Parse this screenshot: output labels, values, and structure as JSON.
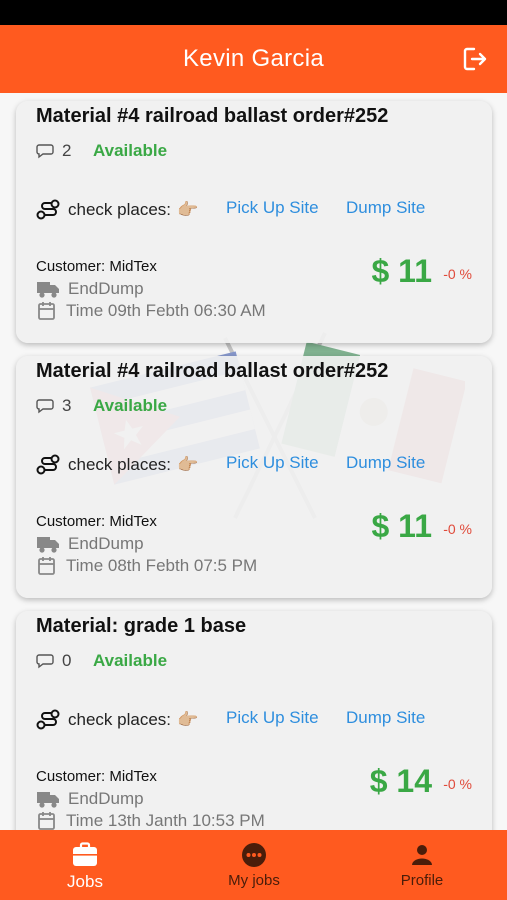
{
  "header": {
    "title": "Kevin Garcia",
    "logout_icon": "logout-icon"
  },
  "jobs": [
    {
      "material": "Material #4 railroad ballast  order#252",
      "comments": "2",
      "status": "Available",
      "check_label": "check places:",
      "hand_icon": "👉🏼",
      "pickup_link": "Pick Up Site",
      "dump_link": "Dump Site",
      "customer": "Customer: MidTex",
      "truck_type": "EndDump",
      "time": "Time 09th Febth 06:30 AM",
      "price": "$ 11",
      "change": "-0 %"
    },
    {
      "material": "Material #4 railroad ballast  order#252",
      "comments": "3",
      "status": "Available",
      "check_label": "check places:",
      "hand_icon": "👉🏼",
      "pickup_link": "Pick Up Site",
      "dump_link": "Dump Site",
      "customer": "Customer: MidTex",
      "truck_type": "EndDump",
      "time": "Time 08th Febth 07:5 PM",
      "price": "$ 11",
      "change": "-0 %"
    },
    {
      "material": "Material: grade 1 base",
      "comments": "0",
      "status": "Available",
      "check_label": "check places:",
      "hand_icon": "👉🏼",
      "pickup_link": "Pick Up Site",
      "dump_link": "Dump Site",
      "customer": "Customer: MidTex",
      "truck_type": "EndDump",
      "time": "Time 13th Janth 10:53 PM",
      "price": "$ 14",
      "change": "-0 %"
    }
  ],
  "nav": {
    "jobs": "Jobs",
    "my_jobs": "My jobs",
    "profile": "Profile"
  },
  "colors": {
    "brand": "#ff5a1f",
    "available": "#3aa845",
    "link": "#2e8ede",
    "change": "#e04a3a"
  }
}
